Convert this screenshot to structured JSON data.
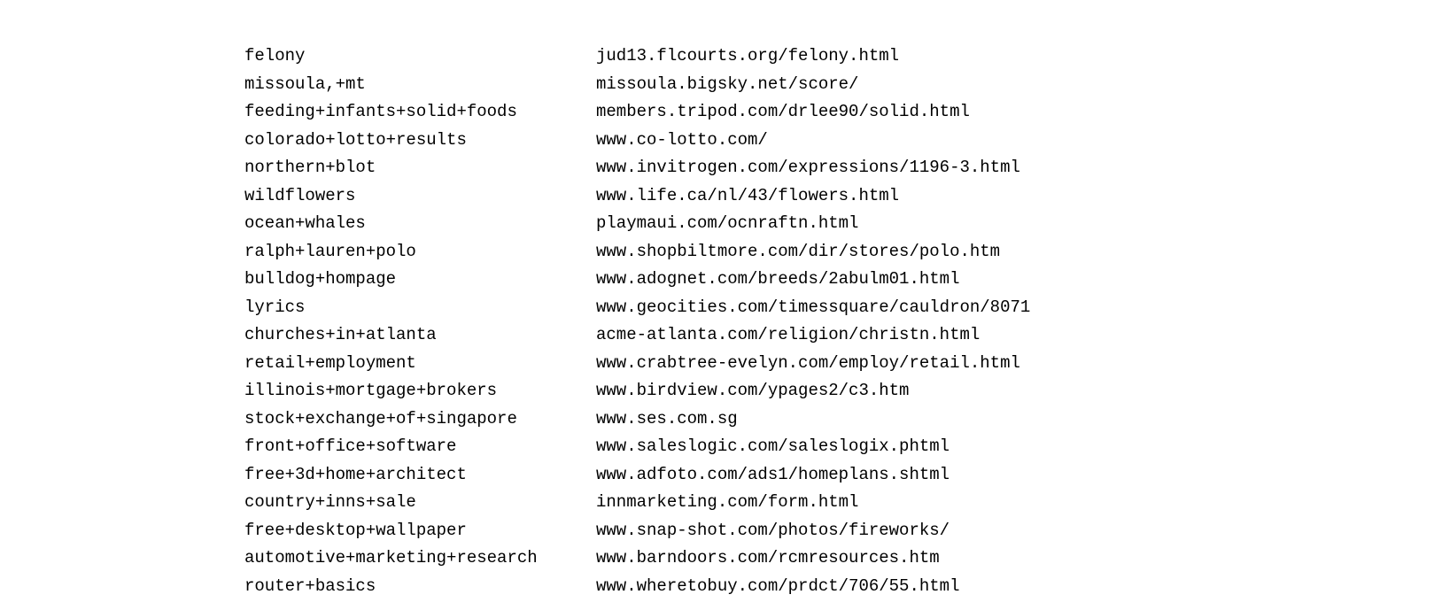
{
  "rows": [
    {
      "query": "felony",
      "url": "jud13.flcourts.org/felony.html"
    },
    {
      "query": "missoula,+mt",
      "url": "missoula.bigsky.net/score/"
    },
    {
      "query": "feeding+infants+solid+foods",
      "url": "members.tripod.com/drlee90/solid.html"
    },
    {
      "query": "colorado+lotto+results",
      "url": "www.co-lotto.com/"
    },
    {
      "query": "northern+blot",
      "url": "www.invitrogen.com/expressions/1196-3.html"
    },
    {
      "query": "wildflowers",
      "url": "www.life.ca/nl/43/flowers.html"
    },
    {
      "query": "ocean+whales",
      "url": "playmaui.com/ocnraftn.html"
    },
    {
      "query": "ralph+lauren+polo",
      "url": "www.shopbiltmore.com/dir/stores/polo.htm"
    },
    {
      "query": "bulldog+hompage",
      "url": "www.adognet.com/breeds/2abulm01.html"
    },
    {
      "query": "lyrics",
      "url": "www.geocities.com/timessquare/cauldron/8071"
    },
    {
      "query": "churches+in+atlanta",
      "url": "acme-atlanta.com/religion/christn.html"
    },
    {
      "query": "retail+employment",
      "url": "www.crabtree-evelyn.com/employ/retail.html"
    },
    {
      "query": "illinois+mortgage+brokers",
      "url": "www.birdview.com/ypages2/c3.htm"
    },
    {
      "query": "stock+exchange+of+singapore",
      "url": "www.ses.com.sg"
    },
    {
      "query": "front+office+software",
      "url": "www.saleslogic.com/saleslogix.phtml"
    },
    {
      "query": "free+3d+home+architect",
      "url": "www.adfoto.com/ads1/homeplans.shtml"
    },
    {
      "query": "country+inns+sale",
      "url": "innmarketing.com/form.html"
    },
    {
      "query": "free+desktop+wallpaper",
      "url": "www.snap-shot.com/photos/fireworks/"
    },
    {
      "query": "automotive+marketing+research",
      "url": "www.barndoors.com/rcmresources.htm"
    },
    {
      "query": "router+basics",
      "url": "www.wheretobuy.com/prdct/706/55.html"
    }
  ]
}
